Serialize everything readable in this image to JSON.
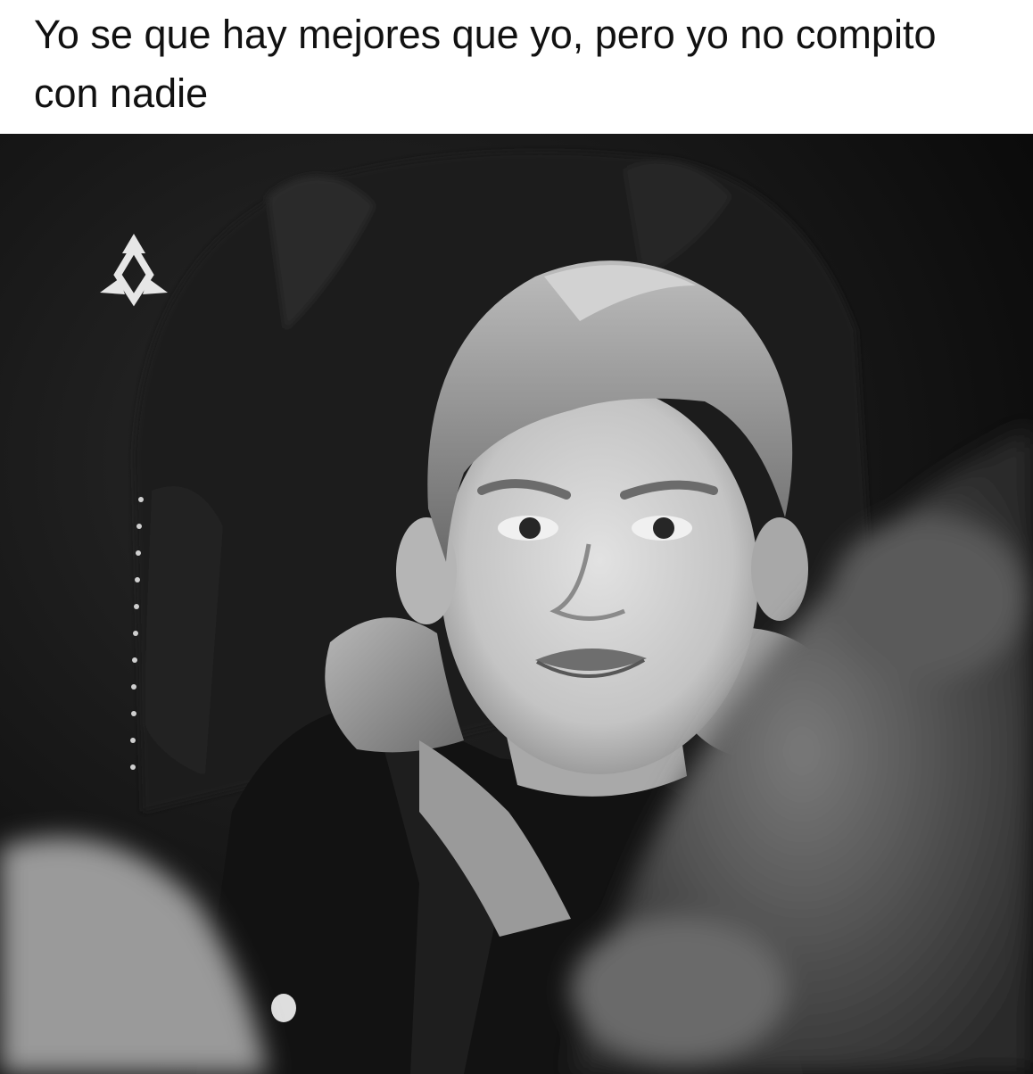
{
  "caption": {
    "text": "Yo se que hay mejores que yo, pero yo no compito con nadie"
  },
  "photo": {
    "style": "black-and-white",
    "subject": "boy-in-leather-armchair"
  },
  "logo": {
    "icon": "triangle-diamond-logo-icon",
    "color": "#e6e6e6"
  }
}
